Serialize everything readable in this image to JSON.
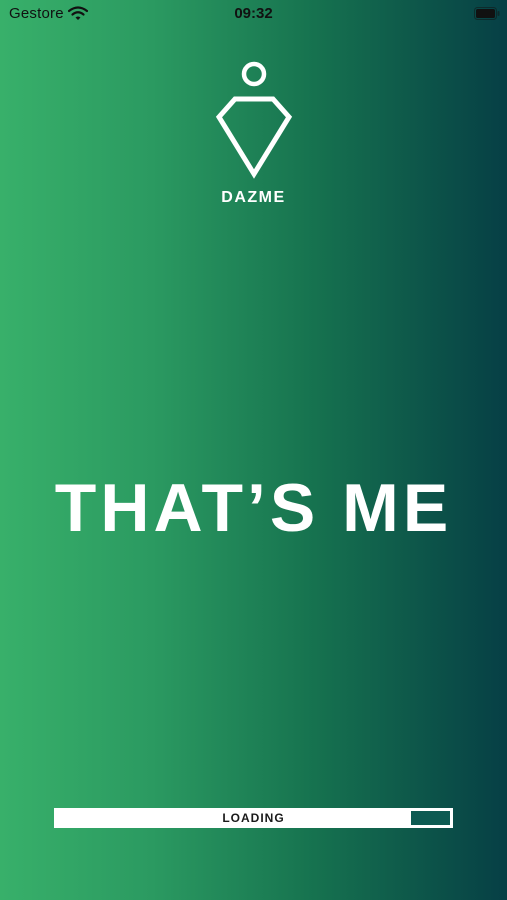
{
  "status_bar": {
    "carrier": "Gestore",
    "time": "09:32",
    "icons": [
      "wifi-icon",
      "battery-icon"
    ]
  },
  "logo": {
    "icon": "dazme-logo-icon",
    "brand": "DAZME"
  },
  "headline": "THAT’S ME",
  "loading": {
    "label": "LOADING",
    "progress_remaining_fraction": 0.1
  },
  "colors": {
    "gradient_start": "#38b06a",
    "gradient_end": "#063f45",
    "text": "#ffffff",
    "loading_fill": "#0d5a52"
  }
}
